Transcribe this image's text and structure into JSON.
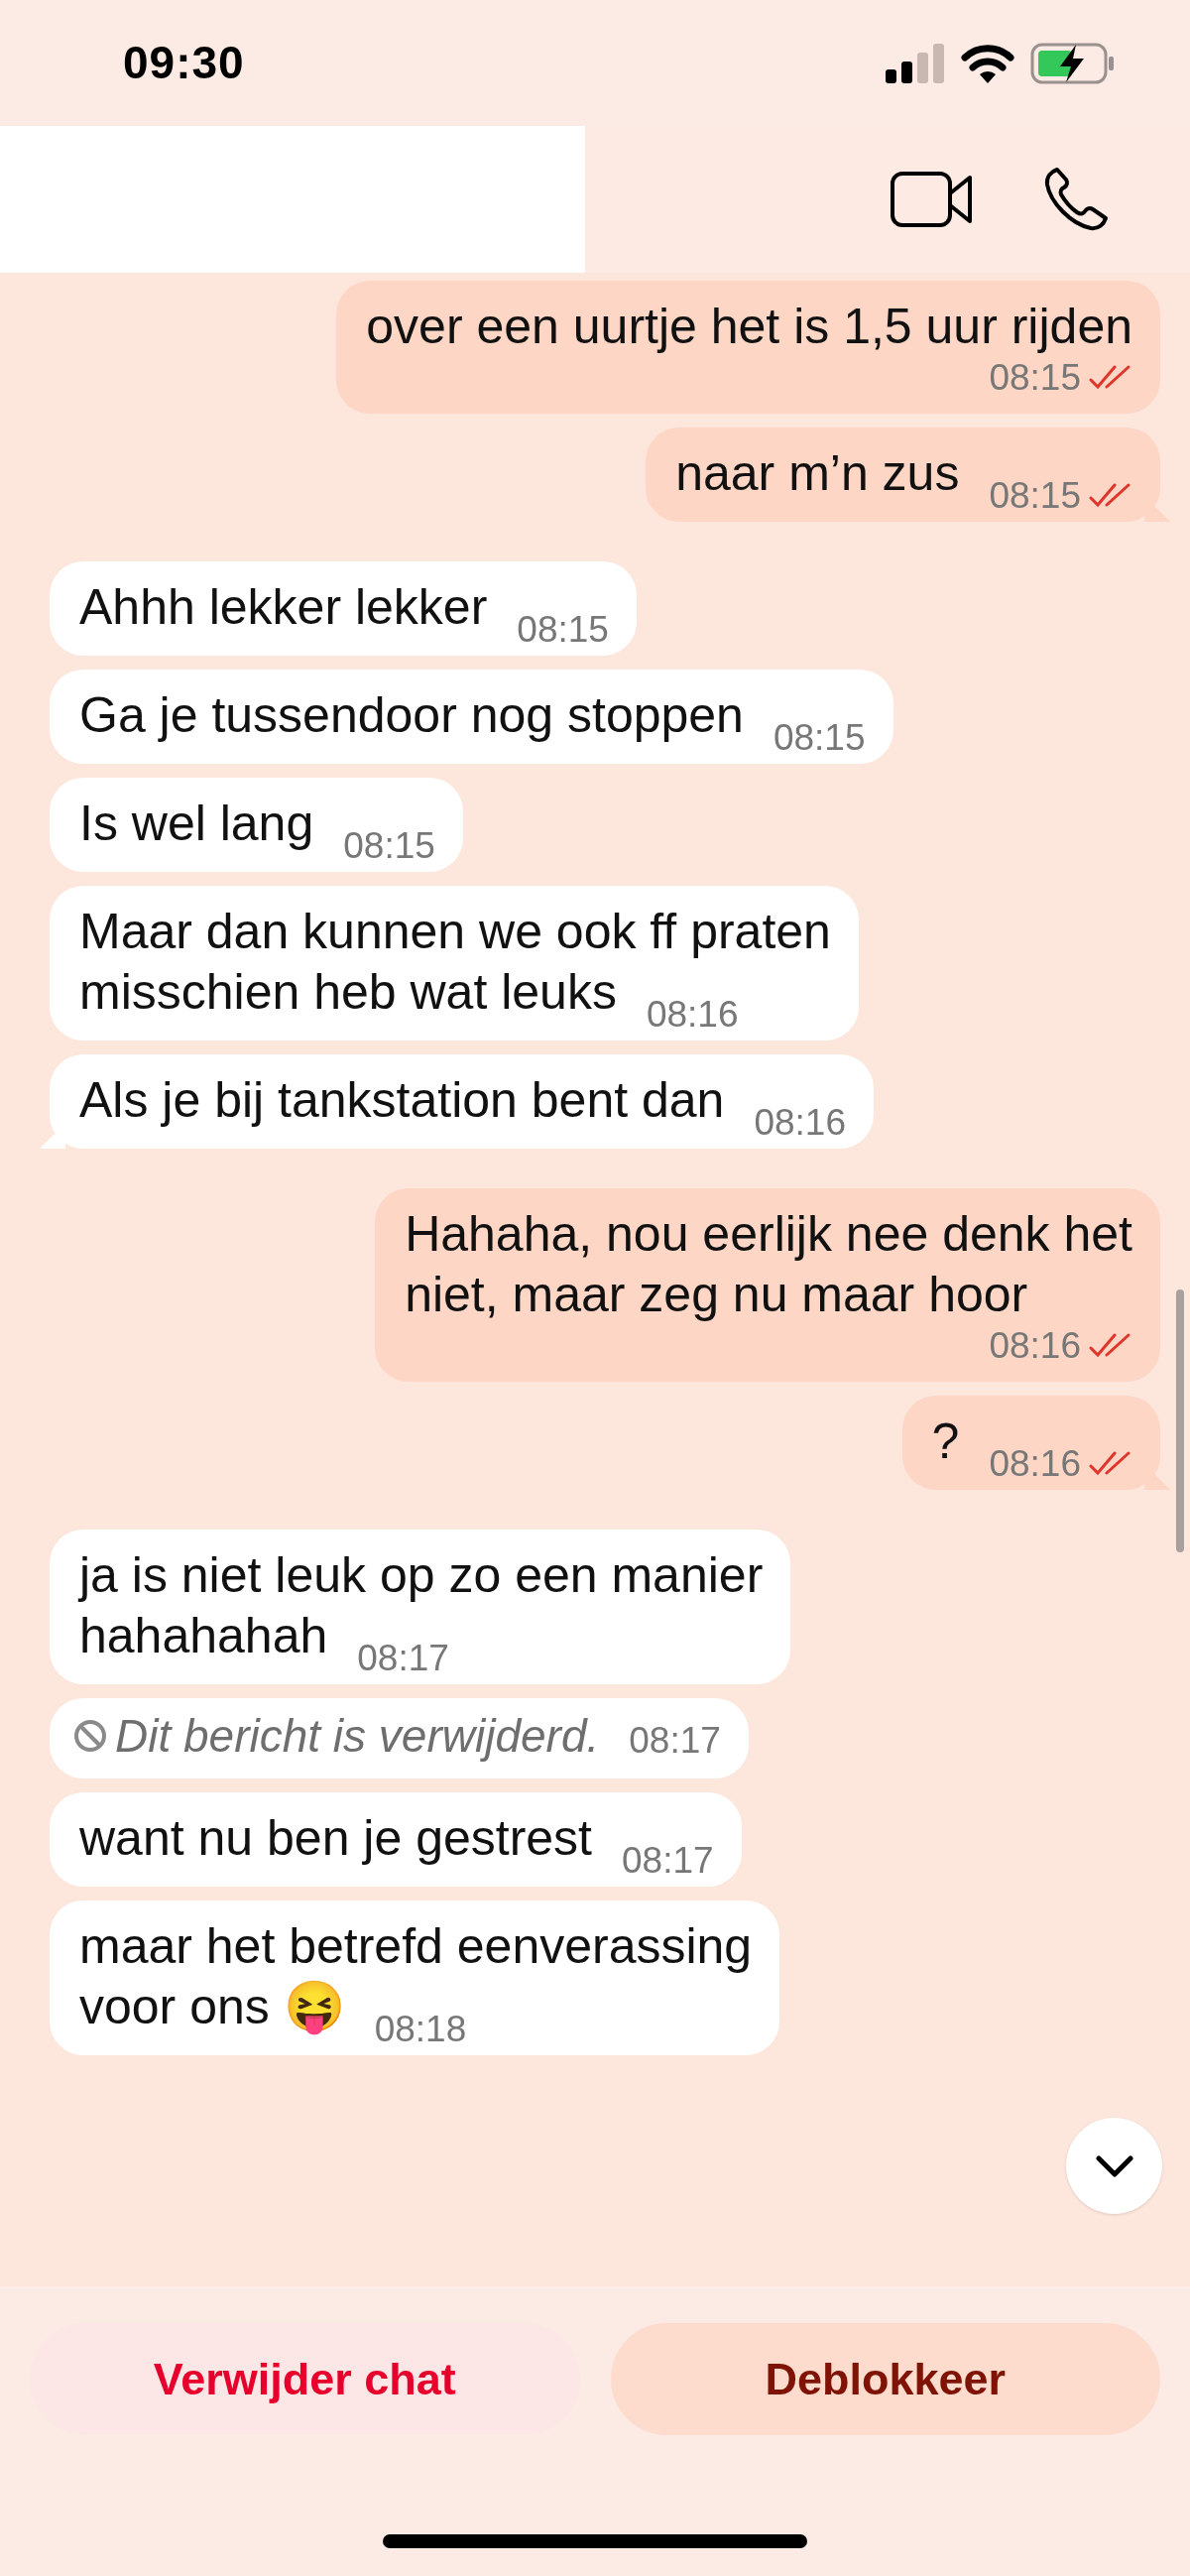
{
  "status_bar": {
    "time": "09:30"
  },
  "messages": [
    {
      "kind": "sent",
      "text": "over een uurtje het is 1,5 uur rijden",
      "time": "08:15",
      "read": true,
      "tail": false
    },
    {
      "kind": "sent",
      "text": "naar m’n zus",
      "time": "08:15",
      "read": true,
      "tail": true
    },
    {
      "kind": "received",
      "text": "Ahhh lekker lekker",
      "time": "08:15",
      "tail": false
    },
    {
      "kind": "received",
      "text": "Ga je tussendoor nog stoppen",
      "time": "08:15",
      "tail": false
    },
    {
      "kind": "received",
      "text": "Is wel lang",
      "time": "08:15",
      "tail": false
    },
    {
      "kind": "received",
      "lines": [
        "Maar dan kunnen we ook ff praten",
        "misschien heb wat leuks"
      ],
      "time": "08:16",
      "tail": false
    },
    {
      "kind": "received",
      "text": "Als je bij tankstation bent dan",
      "time": "08:16",
      "tail": true
    },
    {
      "kind": "sent",
      "lines": [
        "Hahaha, nou eerlijk nee denk het",
        "niet, maar zeg nu maar hoor"
      ],
      "time": "08:16",
      "read": true,
      "tail": false
    },
    {
      "kind": "sent",
      "text": "?",
      "time": "08:16",
      "read": true,
      "tail": true
    },
    {
      "kind": "received",
      "lines": [
        "ja is niet leuk op zo een manier",
        "hahahahah"
      ],
      "time": "08:17",
      "tail": false
    },
    {
      "kind": "deleted",
      "text": "Dit bericht is verwijderd.",
      "time": "08:17",
      "tail": false
    },
    {
      "kind": "received",
      "text": "want nu ben je gestrest",
      "time": "08:17",
      "tail": false
    },
    {
      "kind": "received",
      "lines": [
        "maar het betrefd eenverassing",
        "voor ons 😝"
      ],
      "time": "08:18",
      "tail": false
    }
  ],
  "actions": [
    {
      "label": "Verwijder chat",
      "kind": "destructive"
    },
    {
      "label": "Deblokkeer",
      "kind": "primary"
    }
  ]
}
